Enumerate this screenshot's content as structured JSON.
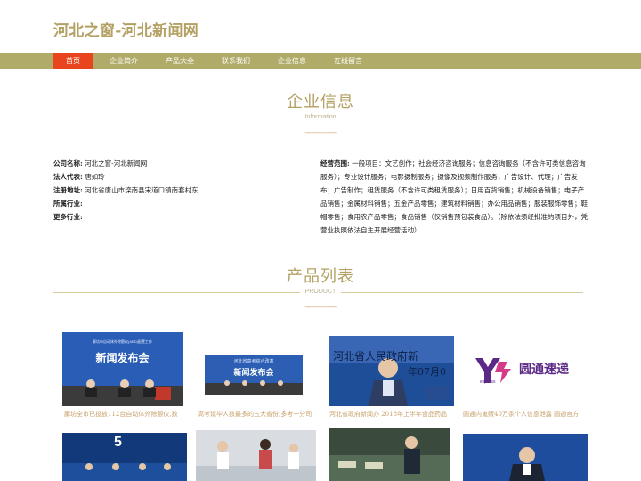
{
  "site": {
    "title": "河北之窗-河北新闻网"
  },
  "nav": {
    "items": [
      {
        "label": "首页",
        "active": true
      },
      {
        "label": "企业简介",
        "active": false
      },
      {
        "label": "产品大全",
        "active": false
      },
      {
        "label": "联系我们",
        "active": false
      },
      {
        "label": "企业信息",
        "active": false
      },
      {
        "label": "在线留言",
        "active": false
      }
    ]
  },
  "company_section": {
    "title": "企业信息",
    "subtitle": "Information",
    "dash": "----------------",
    "fields": [
      {
        "label": "公司名称:",
        "value": "河北之窗-河北新闻网"
      },
      {
        "label": "法人代表:",
        "value": "唐如玲"
      },
      {
        "label": "注册地址:",
        "value": "河北省唐山市滦南县宋道口镇南套村东"
      },
      {
        "label": "所属行业:",
        "value": ""
      },
      {
        "label": "更多行业:",
        "value": ""
      }
    ],
    "scope": {
      "label": "经营范围:",
      "value": "一般项目：文艺创作；社会经济咨询服务；信息咨询服务（不含许可类信息咨询服务）；专业设计服务；电影摄制服务；摄像及视频制作服务；广告设计、代理；广告发布；广告制作；租赁服务（不含许可类租赁服务）；日用百货销售；机械设备销售；电子产品销售；金属材料销售；五金产品零售；建筑材料销售；办公用品销售；服装服饰零售；鞋帽零售；食用农产品零售；食品销售（仅销售预包装食品）。（除依法须经批准的项目外，凭营业执照依法自主开展经营活动）"
    }
  },
  "product_section": {
    "title": "产品列表",
    "subtitle": "PRODUCT",
    "dash": "----------------",
    "items": [
      {
        "caption": "廊坊全市已投放112台自动体外除颤仪,数",
        "image_text": "新闻发布会",
        "image_text_2": "廊坊市自动体外除颤仪(AED)配置工作"
      },
      {
        "caption": "高考延毕人数最多的五大省份,多考一分司",
        "image_text": "新闻发布会",
        "image_text_2": "河北省高考综合改革"
      },
      {
        "caption": "河北省政府新闻办 2018年上半年食品药品",
        "image_text": "河北省人民政府新",
        "image_text_2": "年07月0"
      },
      {
        "caption": "圆通内鬼贩40万条个人信息泄露 圆通官方",
        "image_text": "圆通速递",
        "image_text_2": "express"
      },
      {
        "caption": "",
        "image_text": "5"
      },
      {
        "caption": "",
        "image_text": ""
      },
      {
        "caption": "",
        "image_text": ""
      },
      {
        "caption": "",
        "image_text": ""
      }
    ]
  },
  "colors": {
    "brand_gold": "#b3a063",
    "nav_bar": "#b1ab69",
    "nav_active": "#e8451f",
    "caption": "#c8a06a"
  }
}
